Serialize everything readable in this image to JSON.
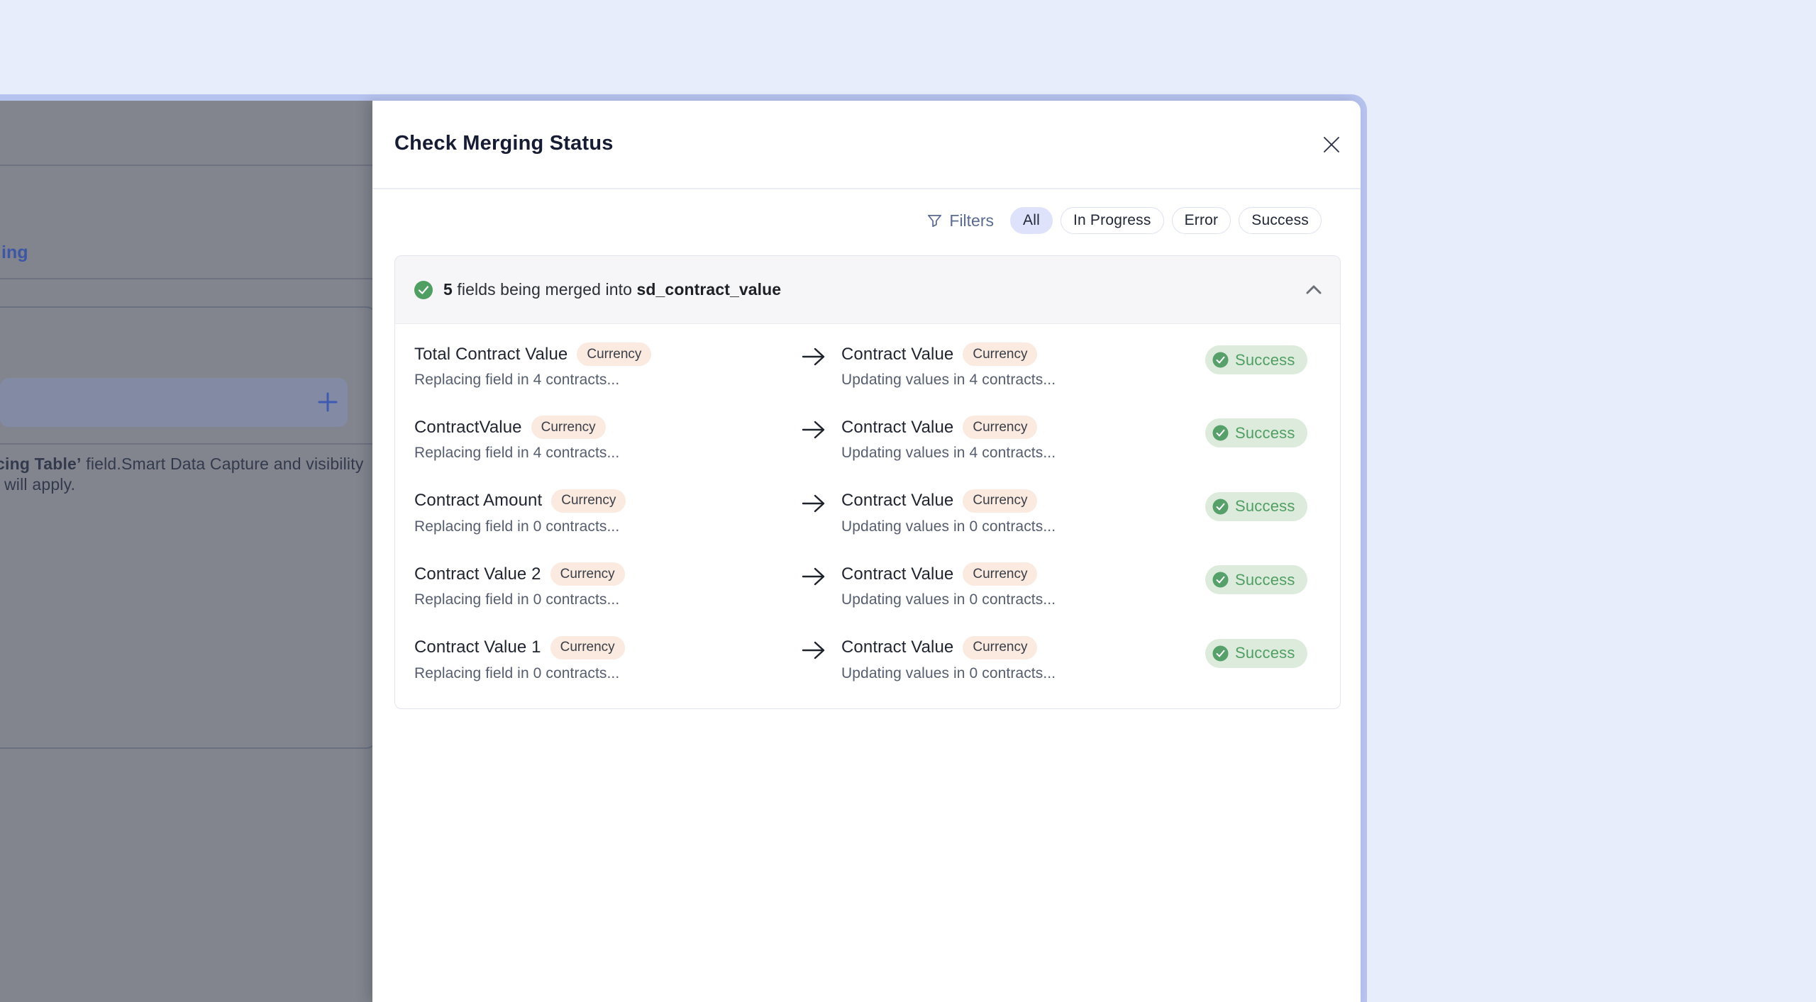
{
  "background_panel": {
    "link_fragment": "ing",
    "note_line1_bold": "cing Table’",
    "note_line1_rest": " field.Smart Data Capture and visibility",
    "note_line2": "will apply."
  },
  "modal": {
    "title": "Check Merging Status",
    "filters": {
      "label": "Filters",
      "options": [
        {
          "label": "All",
          "selected": true
        },
        {
          "label": "In Progress",
          "selected": false
        },
        {
          "label": "Error",
          "selected": false
        },
        {
          "label": "Success",
          "selected": false
        }
      ]
    },
    "group": {
      "count": "5",
      "summary_middle": " fields being merged into ",
      "target_field": "sd_contract_value",
      "rows": [
        {
          "source": {
            "name": "Total Contract Value",
            "type": "Currency",
            "status_text": "Replacing field in 4 contracts..."
          },
          "target": {
            "name": "Contract Value",
            "type": "Currency",
            "status_text": "Updating values in 4 contracts..."
          },
          "status": "Success"
        },
        {
          "source": {
            "name": "ContractValue",
            "type": "Currency",
            "status_text": "Replacing field in 4 contracts..."
          },
          "target": {
            "name": "Contract Value",
            "type": "Currency",
            "status_text": "Updating values in 4 contracts..."
          },
          "status": "Success"
        },
        {
          "source": {
            "name": "Contract Amount",
            "type": "Currency",
            "status_text": "Replacing field in 0 contracts..."
          },
          "target": {
            "name": "Contract Value",
            "type": "Currency",
            "status_text": "Updating values in 0 contracts..."
          },
          "status": "Success"
        },
        {
          "source": {
            "name": "Contract Value 2",
            "type": "Currency",
            "status_text": "Replacing field in 0 contracts..."
          },
          "target": {
            "name": "Contract Value",
            "type": "Currency",
            "status_text": "Updating values in 0 contracts..."
          },
          "status": "Success"
        },
        {
          "source": {
            "name": "Contract Value 1",
            "type": "Currency",
            "status_text": "Replacing field in 0 contracts..."
          },
          "target": {
            "name": "Contract Value",
            "type": "Currency",
            "status_text": "Updating values in 0 contracts..."
          },
          "status": "Success"
        }
      ]
    }
  },
  "icons": {
    "filter": "funnel",
    "close": "x",
    "collapse": "chevron-up",
    "arrow": "arrow-right",
    "status": "check-circle",
    "add": "plus"
  },
  "colors": {
    "page_bg": "#E8EDFC",
    "window_border": "#B7C3EF",
    "dim_overlay": "#82858E",
    "selected_pill_bg": "#DFE2FB",
    "type_badge_bg": "#FAEADF",
    "success_badge_bg": "#DCEBDC",
    "success_green": "#4F9E62",
    "title_text": "#161C33"
  }
}
